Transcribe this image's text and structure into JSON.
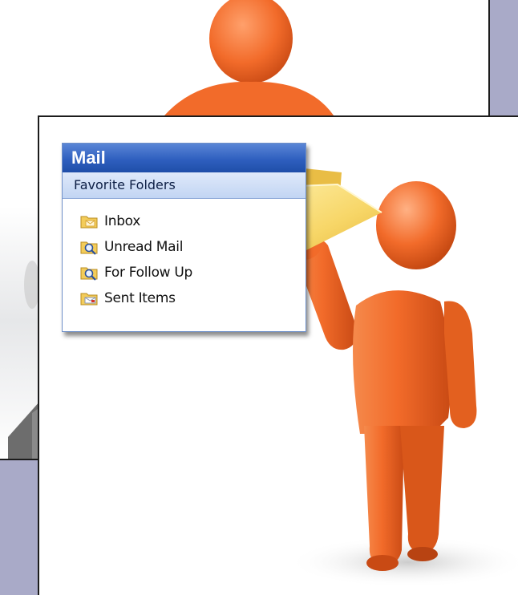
{
  "mail_pane": {
    "title": "Mail",
    "section_header": "Favorite Folders",
    "folders": [
      {
        "label": "Inbox",
        "icon": "inbox-folder-icon"
      },
      {
        "label": "Unread Mail",
        "icon": "search-folder-icon"
      },
      {
        "label": "For Follow Up",
        "icon": "search-folder-icon"
      },
      {
        "label": "Sent Items",
        "icon": "sent-items-folder-icon"
      }
    ]
  },
  "colors": {
    "background": "#a9aac8",
    "figure_orange": "#f26b2a",
    "header_blue": "#2f5fbf",
    "folder_yellow": "#f7d667"
  }
}
